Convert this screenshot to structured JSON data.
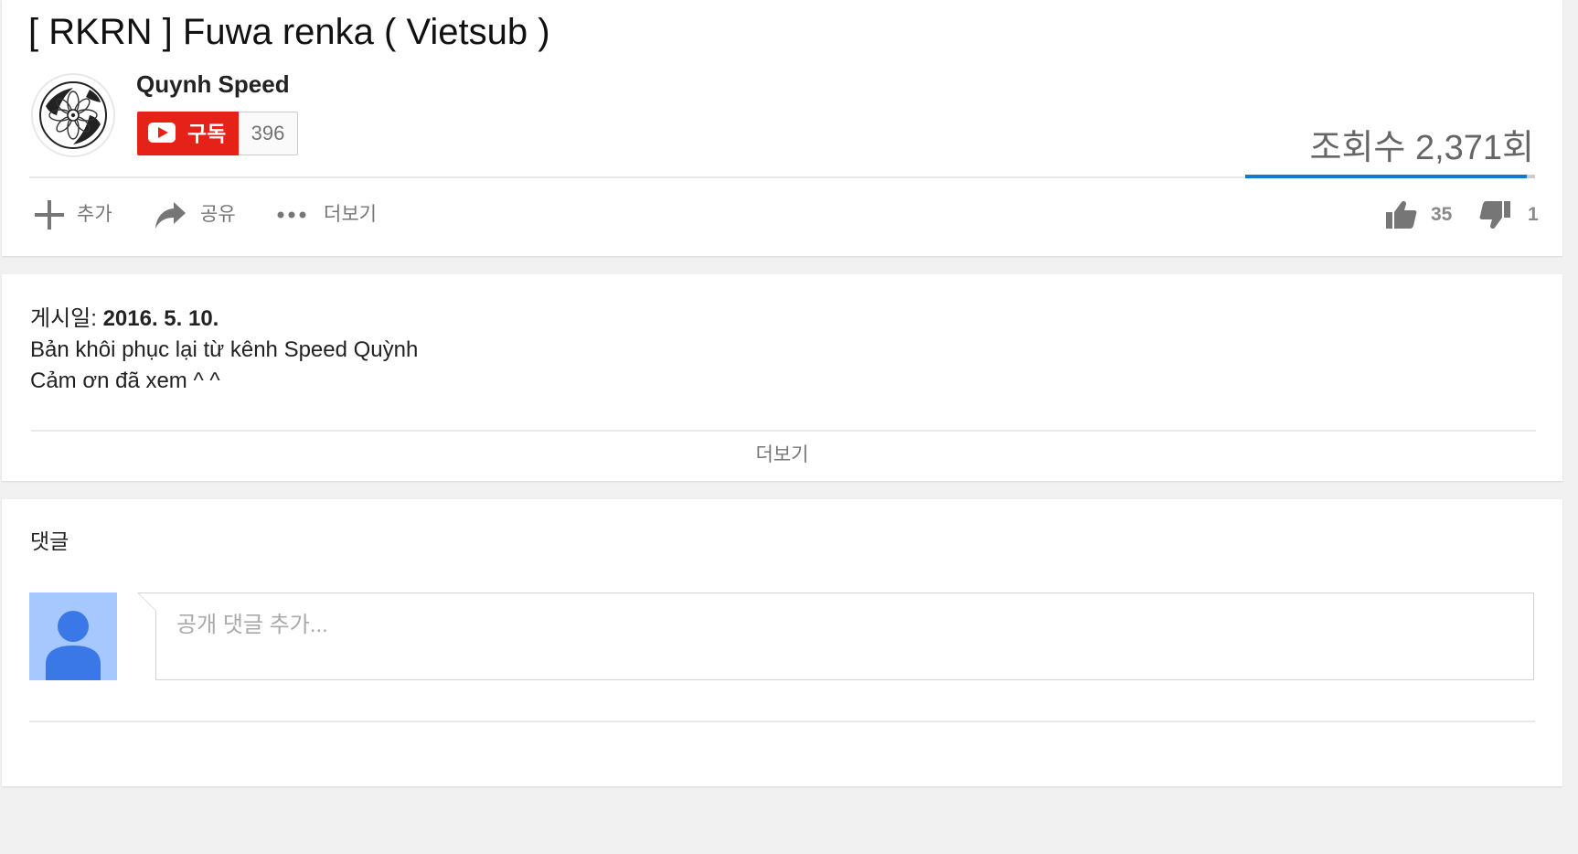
{
  "video": {
    "title": "[ RKRN ] Fuwa renka ( Vietsub )",
    "view_count": "조회수 2,371회"
  },
  "channel": {
    "name": "Quynh Speed",
    "avatar_icon": "flower-lineart-avatar-icon",
    "subscribe_label": "구독",
    "subscriber_count": "396"
  },
  "actions": {
    "add_label": "추가",
    "share_label": "공유",
    "more_label": "더보기",
    "like_count": "35",
    "dislike_count": "1",
    "like_ratio": 0.972
  },
  "description": {
    "published_prefix": "게시일: ",
    "published_date": "2016. 5. 10.",
    "line1": "Bản khôi phục lại từ kênh Speed Quỳnh",
    "line2": "Cảm ơn đã xem ^ ^",
    "show_more": "더보기"
  },
  "comments": {
    "title": "댓글",
    "placeholder": "공개 댓글 추가..."
  },
  "colors": {
    "subscribe_red": "#e62117",
    "sentiment_blue": "#167ac6",
    "avatar_bg": "#a6c8ff",
    "avatar_fg": "#3b78e7",
    "icon_grey": "#767676"
  }
}
